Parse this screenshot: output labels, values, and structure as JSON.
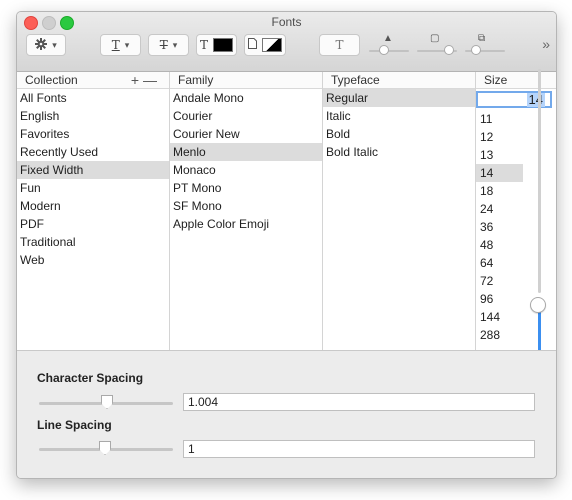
{
  "window": {
    "title": "Fonts"
  },
  "colors": {
    "accent": "#3b8ff0",
    "selection": "#dcdcdc",
    "close": "#fc5f57",
    "maximize": "#2ac940"
  },
  "toolbar": {
    "gear_icon": "gear-icon",
    "underline_glyph": "T",
    "strike_glyph": "T",
    "text_color_glyph": "T",
    "shadow_glyph": "T",
    "more_glyph": "»"
  },
  "collection": {
    "header": "Collection",
    "add_glyph": "+",
    "remove_glyph": "—",
    "items": [
      "All Fonts",
      "English",
      "Favorites",
      "Recently Used",
      "Fixed Width",
      "Fun",
      "Modern",
      "PDF",
      "Traditional",
      "Web"
    ],
    "selected": "Fixed Width"
  },
  "family": {
    "header": "Family",
    "items": [
      "Andale Mono",
      "Courier",
      "Courier New",
      "Menlo",
      "Monaco",
      "PT Mono",
      "SF Mono",
      "Apple Color Emoji"
    ],
    "selected": "Menlo"
  },
  "typeface": {
    "header": "Typeface",
    "items": [
      "Regular",
      "Italic",
      "Bold",
      "Bold Italic"
    ],
    "selected": "Regular"
  },
  "size": {
    "header": "Size",
    "field_value": "14",
    "items": [
      "11",
      "12",
      "13",
      "14",
      "18",
      "24",
      "36",
      "48",
      "64",
      "72",
      "96",
      "144",
      "288"
    ],
    "selected": "14"
  },
  "character_spacing": {
    "label": "Character Spacing",
    "value": "1.004"
  },
  "line_spacing": {
    "label": "Line Spacing",
    "value": "1"
  }
}
